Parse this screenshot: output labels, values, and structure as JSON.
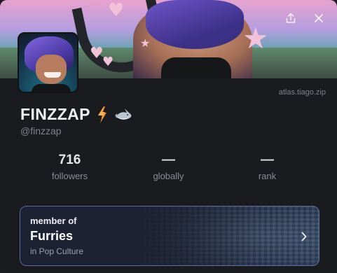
{
  "banner": {
    "actions": [
      {
        "icon": "share-icon"
      },
      {
        "icon": "close-icon"
      }
    ]
  },
  "profile": {
    "site": "atlas.tiago.zip",
    "display_name": "FINZZAP",
    "handle": "@finzzap",
    "name_emojis": [
      "lightning-bolt-emoji",
      "shark-emoji"
    ]
  },
  "stats": [
    {
      "value": "716",
      "label": "followers"
    },
    {
      "value": "—",
      "label": "globally"
    },
    {
      "value": "—",
      "label": "rank"
    }
  ],
  "community": {
    "eyebrow": "member of",
    "name": "Furries",
    "category": "in Pop Culture",
    "icon": "chevron-right-icon"
  },
  "colors": {
    "background": "#1a1b1e",
    "community_border": "#5a6ea3",
    "muted_text": "#7f828b"
  }
}
